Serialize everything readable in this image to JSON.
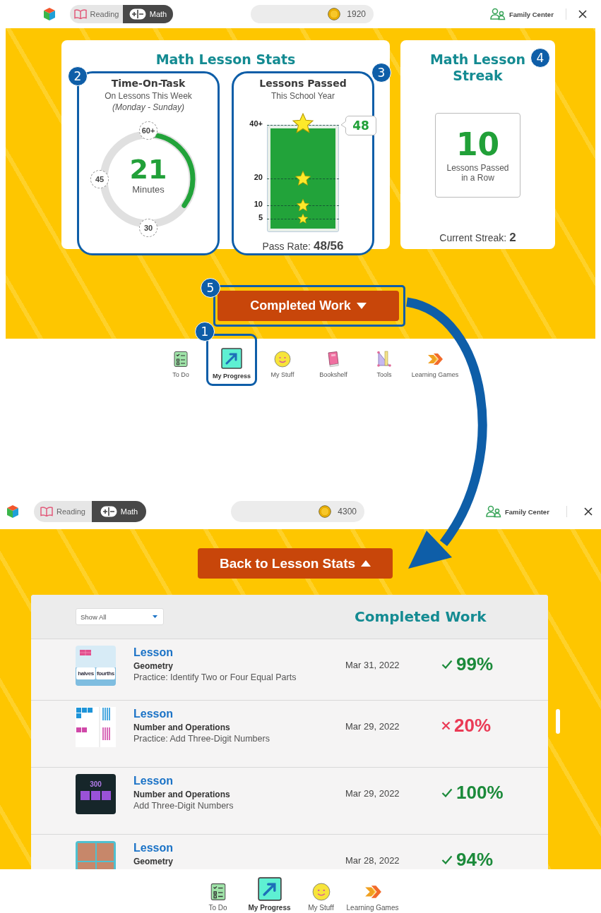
{
  "screens": [
    {
      "top_bar": {
        "subjects": [
          {
            "label": "Reading",
            "selected": false
          },
          {
            "label": "Math",
            "selected": true
          }
        ],
        "coins": "1920",
        "family_center": "Family Center"
      },
      "stats": {
        "title": "Math Lesson Stats",
        "time_on_task": {
          "title": "Time-On-Task",
          "subtitle": "On Lessons This Week",
          "range": "(Monday - Sunday)",
          "value": "21",
          "unit": "Minutes",
          "level": 0.35,
          "ticks": [
            "60+",
            "45",
            "30"
          ]
        },
        "lessons_passed": {
          "title": "Lessons Passed",
          "subtitle": "This School Year",
          "ticks": [
            "40+",
            "20",
            "10",
            "5"
          ],
          "level": 1,
          "count": "48",
          "pass_rate_label": "Pass Rate:",
          "pass_rate": "48/56"
        }
      },
      "streak": {
        "title": "Math Lesson Streak",
        "value": "10",
        "caption": "Lessons Passed in a Row",
        "current_label": "Current Streak:",
        "current": "2"
      },
      "completed_button": "Completed Work",
      "nav": [
        {
          "kind": "todo",
          "label": "To Do",
          "selected": false
        },
        {
          "kind": "progress",
          "label": "My Progress",
          "selected": true
        },
        {
          "kind": "stuff",
          "label": "My Stuff",
          "selected": false
        },
        {
          "kind": "book",
          "label": "Bookshelf",
          "selected": false
        },
        {
          "kind": "tools",
          "label": "Tools",
          "selected": false
        },
        {
          "kind": "games",
          "label": "Learning Games",
          "selected": false
        }
      ]
    },
    {
      "top_bar": {
        "subjects": [
          {
            "label": "Reading",
            "selected": false
          },
          {
            "label": "Math",
            "selected": true
          }
        ],
        "coins": "4300",
        "family_center": "Family Center"
      },
      "back_button": "Back to Lesson Stats",
      "completed_work": {
        "filter": "Show All",
        "title": "Completed Work",
        "rows": [
          {
            "kind": "halves",
            "thumbnail_labels": [
              "halves",
              "fourths"
            ],
            "type": "Lesson",
            "topic": "Geometry",
            "activity": "Practice: Identify Two or Four Equal Parts",
            "date": "Mar 31, 2022",
            "score": "99%",
            "passed": true
          },
          {
            "kind": "blocks",
            "type": "Lesson",
            "topic": "Number and Operations",
            "activity": "Practice: Add Three-Digit Numbers",
            "date": "Mar 29, 2022",
            "score": "20%",
            "passed": false
          },
          {
            "kind": "number",
            "thumbnail_labels": [
              "300"
            ],
            "type": "Lesson",
            "topic": "Number and Operations",
            "activity": "Add Three-Digit Numbers",
            "date": "Mar 29, 2022",
            "score": "100%",
            "passed": true
          },
          {
            "kind": "grid",
            "type": "Lesson",
            "topic": "Geometry",
            "date": "Mar 28, 2022",
            "score": "94%",
            "passed": true
          }
        ]
      },
      "nav": [
        {
          "kind": "todo",
          "label": "To Do",
          "selected": false
        },
        {
          "kind": "progress",
          "label": "My Progress",
          "selected": true
        },
        {
          "kind": "stuff",
          "label": "My Stuff",
          "selected": false
        },
        {
          "kind": "games",
          "label": "Learning Games",
          "selected": false
        }
      ]
    }
  ],
  "callouts": [
    "1",
    "2",
    "3",
    "4",
    "5"
  ]
}
